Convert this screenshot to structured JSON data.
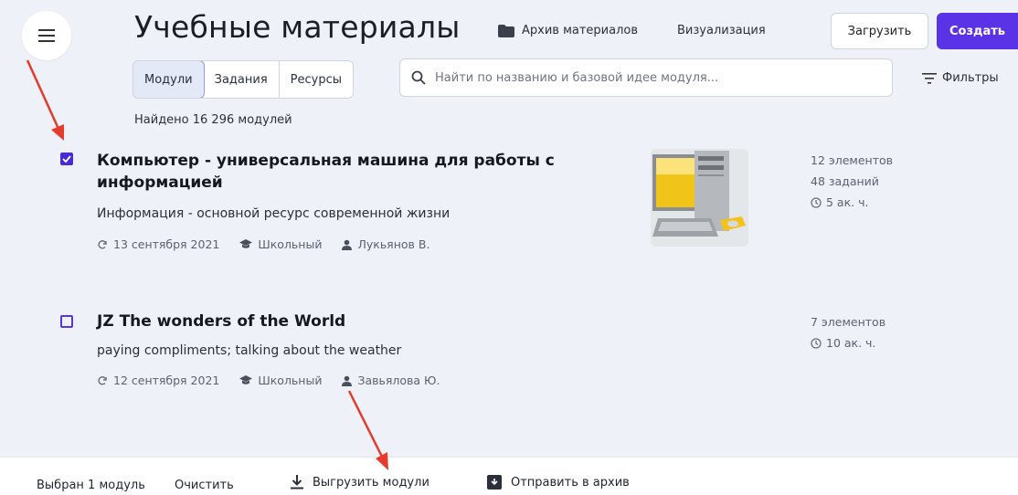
{
  "header": {
    "title": "Учебные материалы",
    "archive_label": "Архив материалов",
    "visualization_label": "Визуализация",
    "upload_label": "Загрузить",
    "create_label": "Создать",
    "accent_color": "#5b33e6"
  },
  "tabs": [
    {
      "label": "Модули",
      "active": true
    },
    {
      "label": "Задания",
      "active": false
    },
    {
      "label": "Ресурсы",
      "active": false
    }
  ],
  "search": {
    "placeholder": "Найти по названию и базовой идее модуля..."
  },
  "filters_label": "Фильтры",
  "found_text": "Найдено 16 296 модулей",
  "modules": [
    {
      "checked": true,
      "title_line1": "Компьютер - универсальная машина для работы с",
      "title_line2": "информацией",
      "subtitle": "Информация - основной ресурс современной жизни",
      "date": "13 сентября 2021",
      "level": "Школьный",
      "author": "Лукьянов В.",
      "elements": "12 элементов",
      "tasks": "48 заданий",
      "hours": "5 ак. ч.",
      "has_thumbnail": true
    },
    {
      "checked": false,
      "title": "JZ The wonders of the World",
      "subtitle": "paying compliments; talking about the weather",
      "date": "12 сентября 2021",
      "level": "Школьный",
      "author": "Завьялова Ю.",
      "elements": "7 элементов",
      "hours": "10 ак. ч.",
      "has_thumbnail": false
    }
  ],
  "bottom_bar": {
    "selected_text": "Выбран 1 модуль",
    "clear_label": "Очистить",
    "export_label": "Выгрузить модули",
    "archive_label": "Отправить в архив"
  },
  "icons": {
    "menu": "hamburger-icon",
    "folder": "folder-icon",
    "search": "search-icon",
    "filter": "filter-icon",
    "sync": "sync-icon",
    "level": "graduation-cap-icon",
    "author": "user-icon",
    "clock": "clock-icon",
    "download": "download-icon",
    "archive": "archive-box-icon"
  },
  "annotation_color": "#e53b2c"
}
